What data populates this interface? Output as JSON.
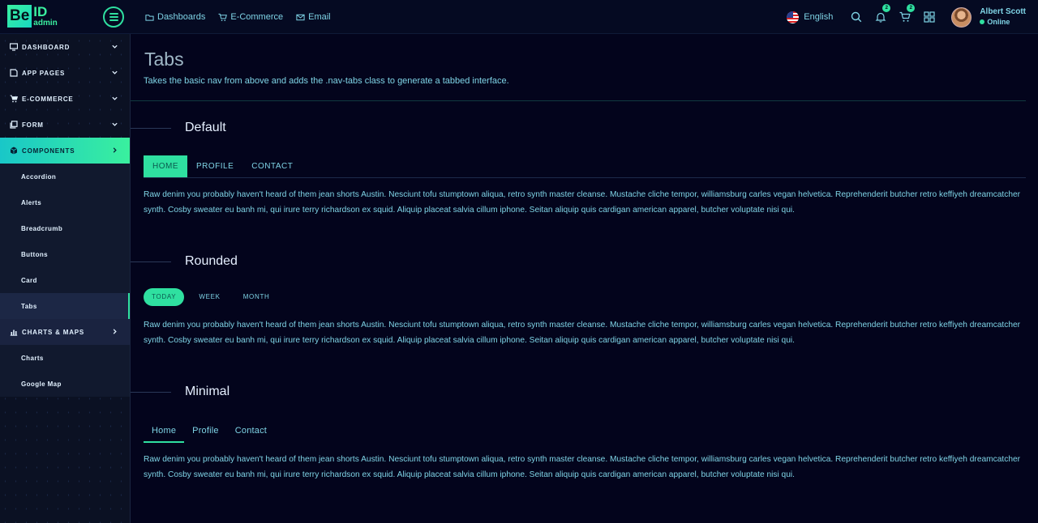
{
  "brand": {
    "be": "Be",
    "id": "ID",
    "admin": "admin"
  },
  "topnav": [
    {
      "label": "Dashboards",
      "icon": "folder-icon"
    },
    {
      "label": "E-Commerce",
      "icon": "cart-icon"
    },
    {
      "label": "Email",
      "icon": "mail-icon"
    }
  ],
  "language": "English",
  "notifications": {
    "bell_count": "2",
    "cart_count": "2"
  },
  "user": {
    "name": "Albert Scott",
    "status": "Online"
  },
  "sidebar": {
    "items": [
      {
        "label": "DASHBOARD"
      },
      {
        "label": "APP PAGES"
      },
      {
        "label": "E-COMMERCE"
      },
      {
        "label": "FORM"
      },
      {
        "label": "COMPONENTS"
      },
      {
        "label": "CHARTS & MAPS"
      }
    ],
    "components_sub": [
      "Accordion",
      "Alerts",
      "Breadcrumb",
      "Buttons",
      "Card",
      "Tabs"
    ],
    "charts_sub": [
      "Charts",
      "Google Map"
    ]
  },
  "page": {
    "title": "Tabs",
    "subtitle": "Takes the basic nav from above and adds the .nav-tabs class to generate a tabbed interface."
  },
  "sections": {
    "default": {
      "title": "Default",
      "tabs": [
        "HOME",
        "PROFILE",
        "CONTACT"
      ]
    },
    "rounded": {
      "title": "Rounded",
      "tabs": [
        "TODAY",
        "WEEK",
        "MONTH"
      ]
    },
    "minimal": {
      "title": "Minimal",
      "tabs": [
        "Home",
        "Profile",
        "Contact"
      ]
    },
    "text": "Raw denim you probably haven't heard of them jean shorts Austin. Nesciunt tofu stumptown aliqua, retro synth master cleanse. Mustache cliche tempor, williamsburg carles vegan helvetica. Reprehenderit butcher retro keffiyeh dreamcatcher synth. Cosby sweater eu banh mi, qui irure terry richardson ex squid. Aliquip placeat salvia cillum iphone. Seitan aliquip quis cardigan american apparel, butcher voluptate nisi qui."
  },
  "colors": {
    "accent": "#2fe0a0",
    "background": "#03041c",
    "text": "#7fd4e6"
  }
}
